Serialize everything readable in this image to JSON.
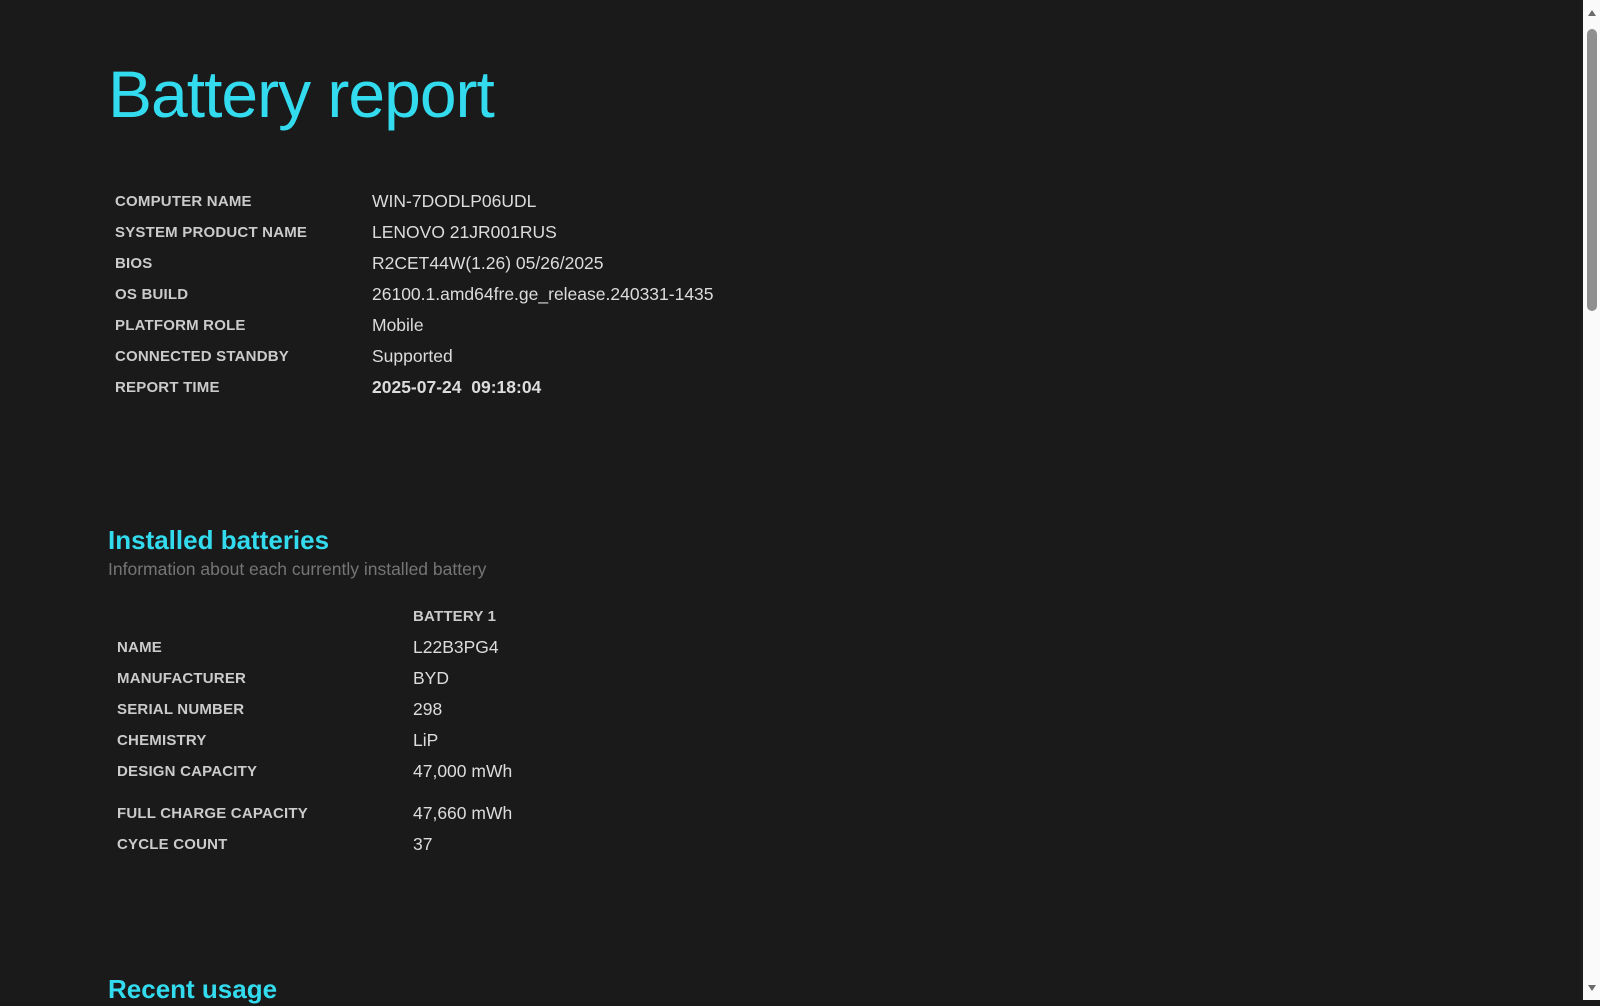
{
  "page": {
    "title": "Battery report"
  },
  "system_info": {
    "rows": [
      {
        "label": "COMPUTER NAME",
        "value": "WIN-7DODLP06UDL"
      },
      {
        "label": "SYSTEM PRODUCT NAME",
        "value": "LENOVO 21JR001RUS"
      },
      {
        "label": "BIOS",
        "value": "R2CET44W(1.26) 05/26/2025"
      },
      {
        "label": "OS BUILD",
        "value": "26100.1.amd64fre.ge_release.240331-1435"
      },
      {
        "label": "PLATFORM ROLE",
        "value": "Mobile"
      },
      {
        "label": "CONNECTED STANDBY",
        "value": "Supported"
      },
      {
        "label": "REPORT TIME",
        "value": "2025-07-24  09:18:04",
        "bold": true
      }
    ]
  },
  "installed_batteries": {
    "heading": "Installed batteries",
    "subtitle": "Information about each currently installed battery",
    "column_header": "BATTERY 1",
    "rows": [
      {
        "label": "NAME",
        "value": "L22B3PG4"
      },
      {
        "label": "MANUFACTURER",
        "value": "BYD"
      },
      {
        "label": "SERIAL NUMBER",
        "value": "298"
      },
      {
        "label": "CHEMISTRY",
        "value": "LiP"
      },
      {
        "label": "DESIGN CAPACITY",
        "value": "47,000 mWh"
      },
      {
        "label": "FULL CHARGE CAPACITY",
        "value": "47,660 mWh",
        "group_gap": true
      },
      {
        "label": "CYCLE COUNT",
        "value": "37"
      }
    ]
  },
  "recent_usage": {
    "heading": "Recent usage"
  },
  "icons": {
    "scroll_up": "triangle-up",
    "scroll_down": "triangle-down"
  },
  "colors": {
    "accent": "#33dbee",
    "background": "#1a1a1a",
    "label": "#cbcbcb",
    "value": "#dcdcdc",
    "subtitle": "#757575",
    "scrollbar_track": "#fafafa",
    "scrollbar_thumb": "#8f8f8f"
  }
}
